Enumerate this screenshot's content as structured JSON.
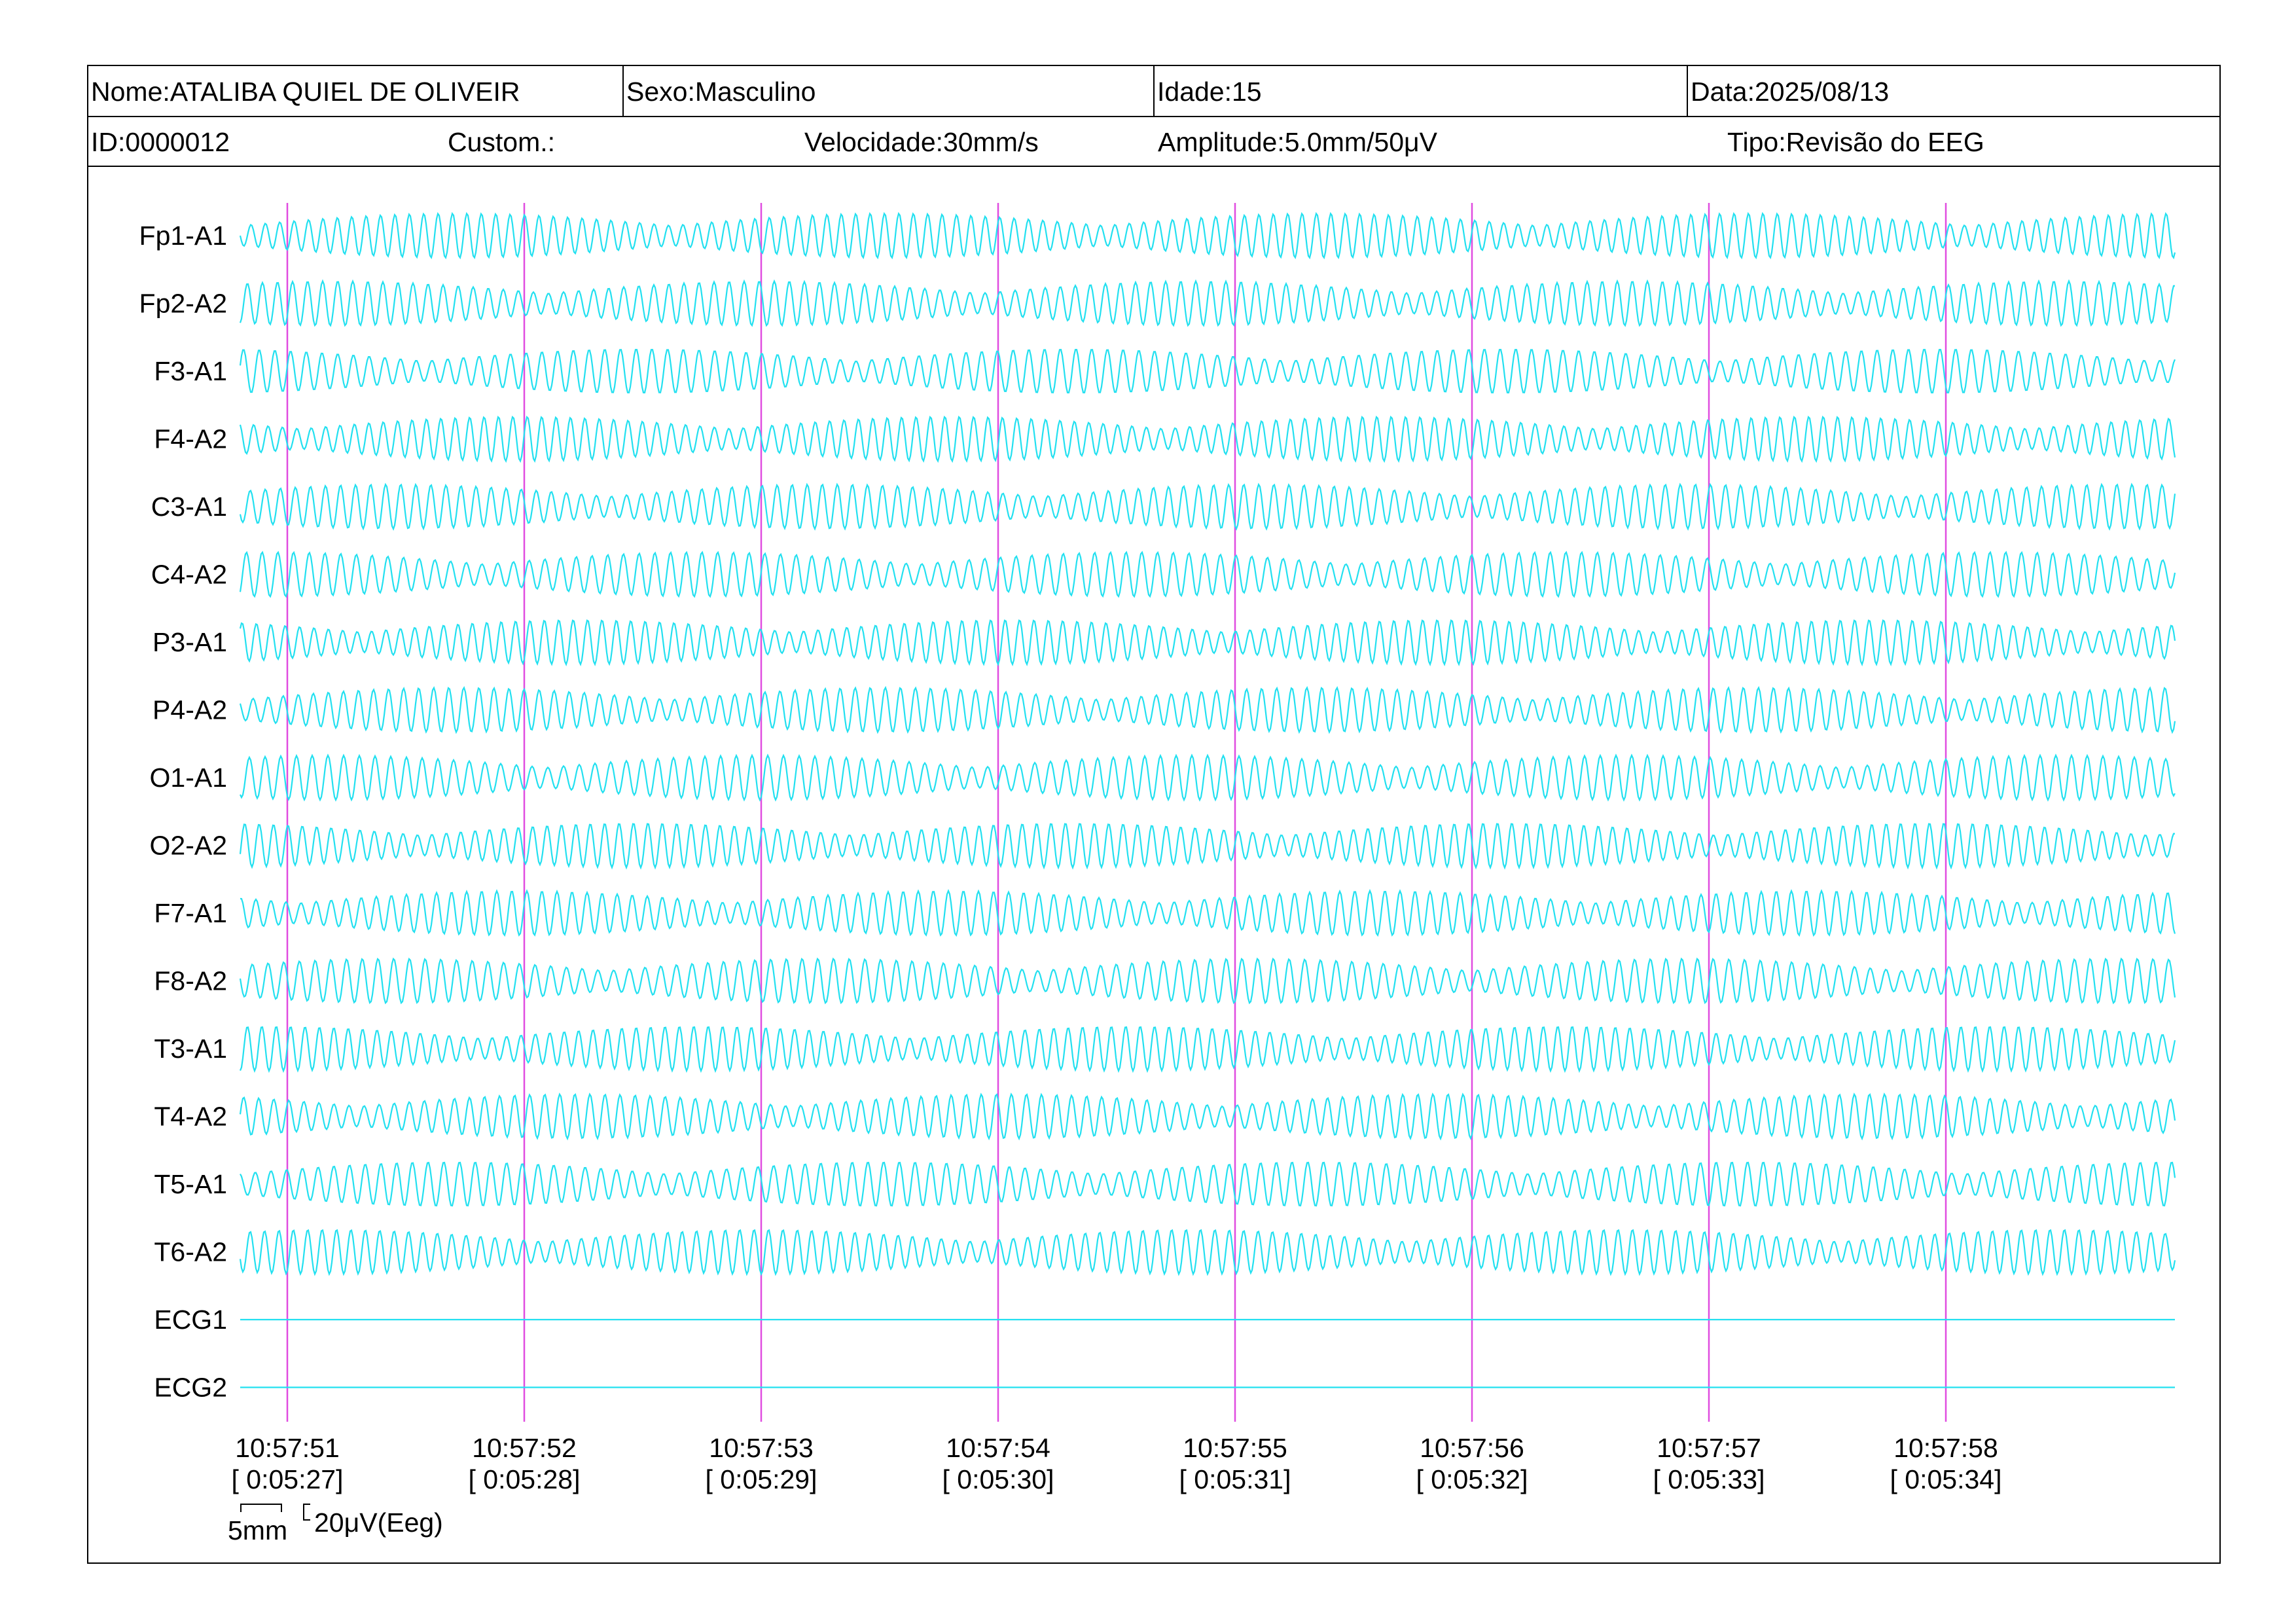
{
  "header": {
    "nome": "Nome:ATALIBA QUIEL DE OLIVEIR",
    "sexo": "Sexo:Masculino",
    "idade": "Idade:15",
    "data": "Data:2025/08/13",
    "id": "ID:0000012",
    "custom": "Custom.:",
    "velocidade": "Velocidade:30mm/s",
    "amplitude": "Amplitude:5.0mm/50μV",
    "tipo": "Tipo:Revisão do EEG"
  },
  "channels": [
    "Fp1-A1",
    "Fp2-A2",
    "F3-A1",
    "F4-A2",
    "C3-A1",
    "C4-A2",
    "P3-A1",
    "P4-A2",
    "O1-A1",
    "O2-A2",
    "F7-A1",
    "F8-A2",
    "T3-A1",
    "T4-A2",
    "T5-A1",
    "T6-A2",
    "ECG1",
    "ECG2"
  ],
  "flat_channels": [
    "ECG1",
    "ECG2"
  ],
  "time_markers": [
    {
      "clock": "10:57:51",
      "elapsed": "[ 0:05:27]"
    },
    {
      "clock": "10:57:52",
      "elapsed": "[ 0:05:28]"
    },
    {
      "clock": "10:57:53",
      "elapsed": "[ 0:05:29]"
    },
    {
      "clock": "10:57:54",
      "elapsed": "[ 0:05:30]"
    },
    {
      "clock": "10:57:55",
      "elapsed": "[ 0:05:31]"
    },
    {
      "clock": "10:57:56",
      "elapsed": "[ 0:05:32]"
    },
    {
      "clock": "10:57:57",
      "elapsed": "[ 0:05:33]"
    },
    {
      "clock": "10:57:58",
      "elapsed": "[ 0:05:34]"
    }
  ],
  "scale_bar": {
    "time": "5mm",
    "amplitude": "20μV(Eeg)"
  },
  "colors": {
    "trace": "#22e0f0",
    "marker": "#e04ce0",
    "border": "#000000"
  }
}
